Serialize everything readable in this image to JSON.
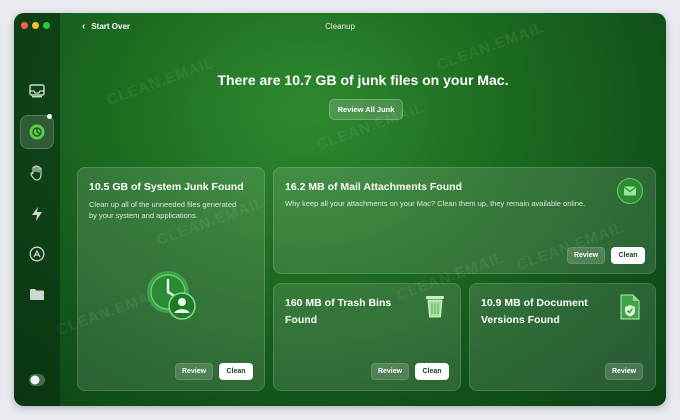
{
  "window": {
    "title": "Cleanup",
    "back_label": "Start Over"
  },
  "header": {
    "headline": "There are 10.7 GB of junk files on your Mac.",
    "review_all_label": "Review All Junk"
  },
  "watermark_text": "CLEAN.EMAIL",
  "sidebar": {
    "items": [
      {
        "icon": "inbox-icon"
      },
      {
        "icon": "cleanup-icon",
        "active": true
      },
      {
        "icon": "hand-privacy-icon"
      },
      {
        "icon": "bolt-icon"
      },
      {
        "icon": "app-store-icon"
      },
      {
        "icon": "folder-icon"
      },
      {
        "icon": "account-toggle-icon"
      }
    ]
  },
  "cards": {
    "system_junk": {
      "title": "10.5 GB of System Junk Found",
      "description": "Clean up all of the unneeded files generated by your system and applications.",
      "icon": "clock-user-icon",
      "review_label": "Review",
      "clean_label": "Clean"
    },
    "mail_attachments": {
      "title": "16.2 MB of Mail Attachments Found",
      "description": "Why keep all your attachments on your Mac? Clean them up, they remain available online.",
      "icon": "mail-icon",
      "review_label": "Review",
      "clean_label": "Clean"
    },
    "trash_bins": {
      "title": "160 MB of Trash Bins Found",
      "icon": "trash-icon",
      "review_label": "Review",
      "clean_label": "Clean"
    },
    "document_versions": {
      "title": "10.9 MB of Document Versions Found",
      "icon": "document-shield-icon",
      "review_label": "Review"
    }
  },
  "colors": {
    "bg_green": "#1c6a20",
    "accent_green": "#4caf50",
    "clean_button": "#ffffff"
  }
}
